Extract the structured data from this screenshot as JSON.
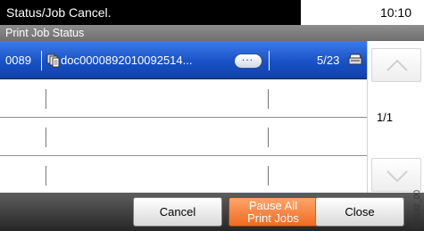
{
  "status_bar": {
    "title": "Status/Job Cancel.",
    "time": "10:10"
  },
  "subheader": {
    "title": "Print Job Status"
  },
  "jobs": [
    {
      "id": "0089",
      "name": "doc0000892010092514...",
      "pages": "5/23",
      "detail_label": "..."
    }
  ],
  "pagination": {
    "indicator": "1/1"
  },
  "footer": {
    "cancel_label": "Cancel",
    "pause_line1": "Pause All",
    "pause_line2": "Print Jobs",
    "close_label": "Close"
  },
  "side_code": "380182_00",
  "colors": {
    "selected_row": "#1852c6",
    "pause_button": "#f06b22"
  }
}
